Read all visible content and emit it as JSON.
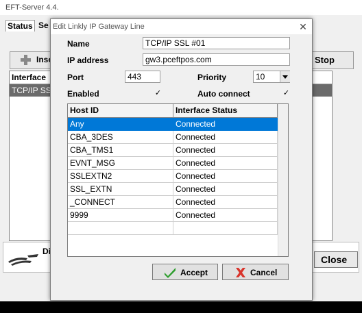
{
  "main_window": {
    "title": "EFT-Server 4.4.",
    "tabs": [
      "Status",
      "Se"
    ],
    "insert_label": "Inse",
    "stop_label": "Stop",
    "list_header": "Interface",
    "list_row": "TCP/IP SSL",
    "panel_label": "Di",
    "close_label": "Close"
  },
  "dialog": {
    "title": "Edit Linkly IP Gateway Line",
    "close_icon": "close-icon",
    "name_label": "Name",
    "name_value": "TCP/IP SSL #01",
    "ip_label": "IP address",
    "ip_value": "gw3.pceftpos.com",
    "port_label": "Port",
    "port_value": "443",
    "priority_label": "Priority",
    "priority_value": "10",
    "enabled_label": "Enabled",
    "enabled_checked": true,
    "auto_connect_label": "Auto connect",
    "auto_connect_checked": true,
    "grid": {
      "columns": [
        "Host ID",
        "Interface Status"
      ],
      "rows": [
        [
          "Any",
          "Connected"
        ],
        [
          "CBA_3DES",
          "Connected"
        ],
        [
          "CBA_TMS1",
          "Connected"
        ],
        [
          "EVNT_MSG",
          "Connected"
        ],
        [
          "SSLEXTN2",
          "Connected"
        ],
        [
          "SSL_EXTN",
          "Connected"
        ],
        [
          "_CONNECT",
          "Connected"
        ],
        [
          "9999",
          "Connected"
        ],
        [
          "",
          ""
        ]
      ],
      "selected_index": 0
    },
    "accept_label": "Accept",
    "cancel_label": "Cancel"
  },
  "colors": {
    "selection": "#0078d7",
    "accept_check": "#2e9e2e",
    "cancel_x": "#d9342b"
  }
}
